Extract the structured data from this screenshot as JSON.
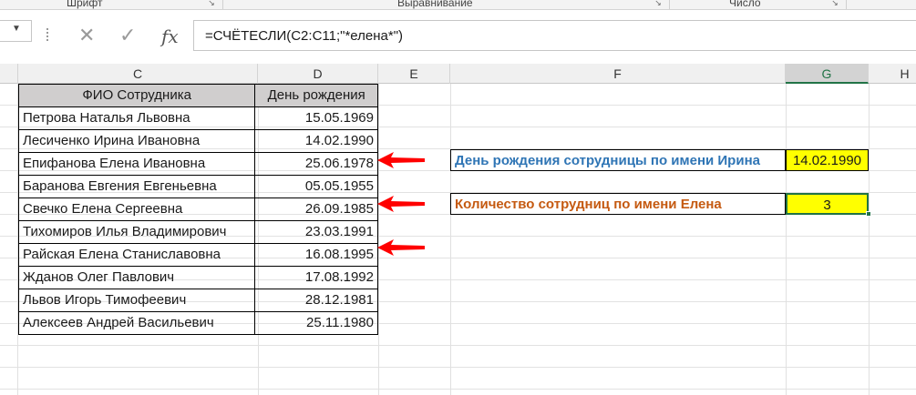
{
  "ribbon": {
    "groups": [
      "Шрифт",
      "Выравнивание",
      "Число"
    ]
  },
  "formula_bar": {
    "cancel_glyph": "✕",
    "enter_glyph": "✓",
    "fx_label": "fx",
    "formula": "=СЧЁТЕСЛИ(C2:C11;\"*елена*\")"
  },
  "columns": [
    "C",
    "D",
    "E",
    "F",
    "G",
    "H"
  ],
  "selected_column": "G",
  "table": {
    "headers": [
      "ФИО Сотрудника",
      "День рождения"
    ],
    "rows": [
      {
        "name": "Петрова Наталья Львовна",
        "date": "15.05.1969"
      },
      {
        "name": "Лесиченко Ирина Ивановна",
        "date": "14.02.1990"
      },
      {
        "name": "Епифанова Елена Ивановна",
        "date": "25.06.1978"
      },
      {
        "name": "Баранова Евгения Евгеньевна",
        "date": "05.05.1955"
      },
      {
        "name": "Свечко Елена Сергеевна",
        "date": "26.09.1985"
      },
      {
        "name": "Тихомиров Илья Владимирович",
        "date": "23.03.1991"
      },
      {
        "name": "Райская Елена Станиславовна",
        "date": "16.08.1995"
      },
      {
        "name": "Жданов Олег Павлович",
        "date": "17.08.1992"
      },
      {
        "name": "Львов Игорь Тимофеевич",
        "date": "28.12.1981"
      },
      {
        "name": "Алексеев Андрей Васильевич",
        "date": "25.11.1980"
      }
    ]
  },
  "summary": {
    "irina_label": "День рождения сотрудницы по имени Ирина",
    "irina_value": "14.02.1990",
    "elena_label": "Количество сотрудниц по имени Елена",
    "elena_value": "3"
  },
  "colors": {
    "header_fill": "#d0cece",
    "highlight_fill": "#ffff00",
    "blue_label": "#2f75b5",
    "orange_label": "#c55a11",
    "arrow": "#ff0000",
    "selection": "#217346"
  }
}
